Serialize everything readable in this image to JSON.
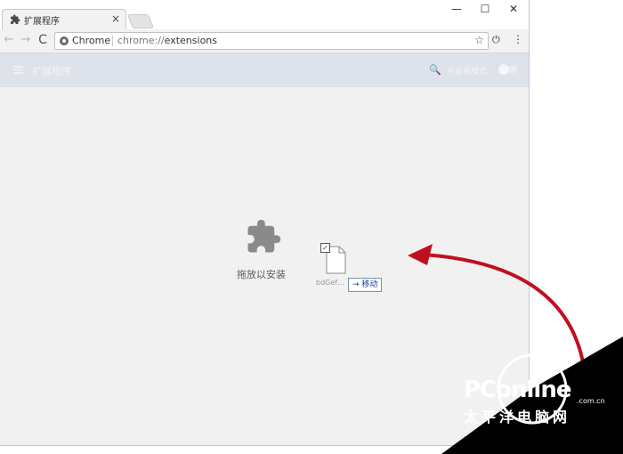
{
  "tab": {
    "title": "扩展程序",
    "close": "×"
  },
  "window_controls": {
    "minimize": "—",
    "maximize": "☐",
    "close": "✕"
  },
  "toolbar": {
    "back": "←",
    "forward": "→",
    "reload": "C",
    "site_label": "Chrome",
    "url_scheme": "chrome://",
    "url_path": "extensions",
    "star": "☆",
    "power": "⏻",
    "menu": "⋮"
  },
  "extensions_header": {
    "title": "扩展程序",
    "search": "🔍",
    "devmode_label": "开发者模式"
  },
  "drop_zone": {
    "label": "拖放以安装"
  },
  "drag": {
    "file_name": "bdGef…",
    "check": "✓",
    "move_tip": "→ 移动"
  },
  "watermark": {
    "brand": "PConline",
    "domain": ".com.cn",
    "cn": "太平洋电脑网"
  },
  "colors": {
    "arrow": "#c0101f",
    "header_bg": "#dde2eb",
    "page_bg": "#f1f1f1"
  }
}
